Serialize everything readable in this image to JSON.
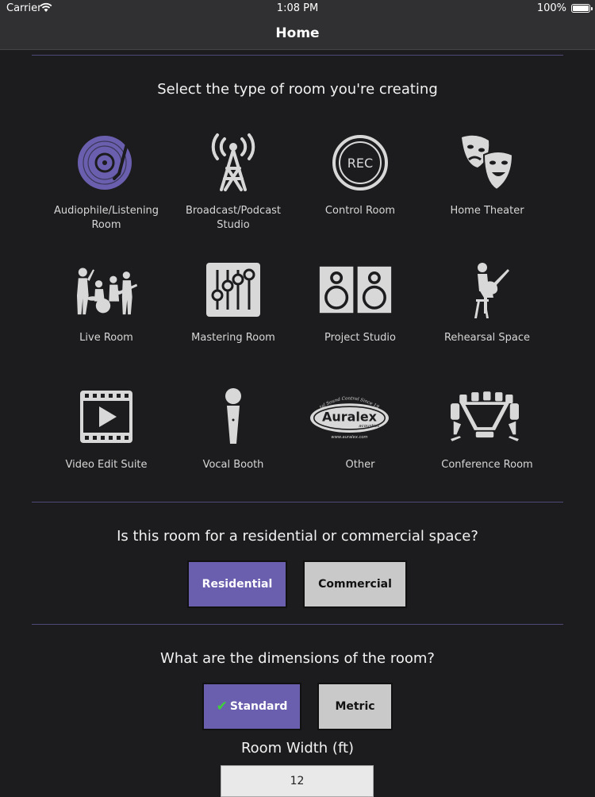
{
  "status_bar": {
    "carrier": "Carrier",
    "time": "1:08 PM",
    "battery": "100%"
  },
  "nav": {
    "title": "Home"
  },
  "room_type": {
    "prompt": "Select the type of room you're creating",
    "options": [
      {
        "label": "Audiophile/Listening Room",
        "icon": "vinyl-record-icon",
        "selected": true
      },
      {
        "label": "Broadcast/Podcast Studio",
        "icon": "broadcast-tower-icon"
      },
      {
        "label": "Control Room",
        "icon": "rec-icon",
        "icon_text": "REC"
      },
      {
        "label": "Home Theater",
        "icon": "theater-masks-icon"
      },
      {
        "label": "Live Room",
        "icon": "live-band-icon"
      },
      {
        "label": "Mastering Room",
        "icon": "mixer-faders-icon"
      },
      {
        "label": "Project Studio",
        "icon": "speakers-icon"
      },
      {
        "label": "Rehearsal Space",
        "icon": "guitarist-icon"
      },
      {
        "label": "Video Edit Suite",
        "icon": "film-play-icon"
      },
      {
        "label": "Vocal Booth",
        "icon": "microphone-icon"
      },
      {
        "label": "Other",
        "icon": "auralex-logo",
        "logo_text": "Auralex",
        "logo_sub": "acoustics",
        "logo_top": "Total Sound Control Since 1977",
        "logo_bottom": "www.auralex.com"
      },
      {
        "label": "Conference Room",
        "icon": "conference-table-icon"
      }
    ]
  },
  "space_type": {
    "prompt": "Is this room for a residential or commercial space?",
    "options": [
      {
        "label": "Residential",
        "selected": true
      },
      {
        "label": "Commercial",
        "selected": false
      }
    ]
  },
  "units": {
    "prompt": "What are the dimensions of the room?",
    "options": [
      {
        "label": "Standard",
        "selected": true
      },
      {
        "label": "Metric",
        "selected": false
      }
    ]
  },
  "room_width": {
    "label": "Room Width (ft)",
    "value": "12"
  },
  "colors": {
    "accent": "#6a5fae",
    "icon": "#d8d8d8",
    "background": "#1c1c1e",
    "check": "#3ed13a"
  }
}
